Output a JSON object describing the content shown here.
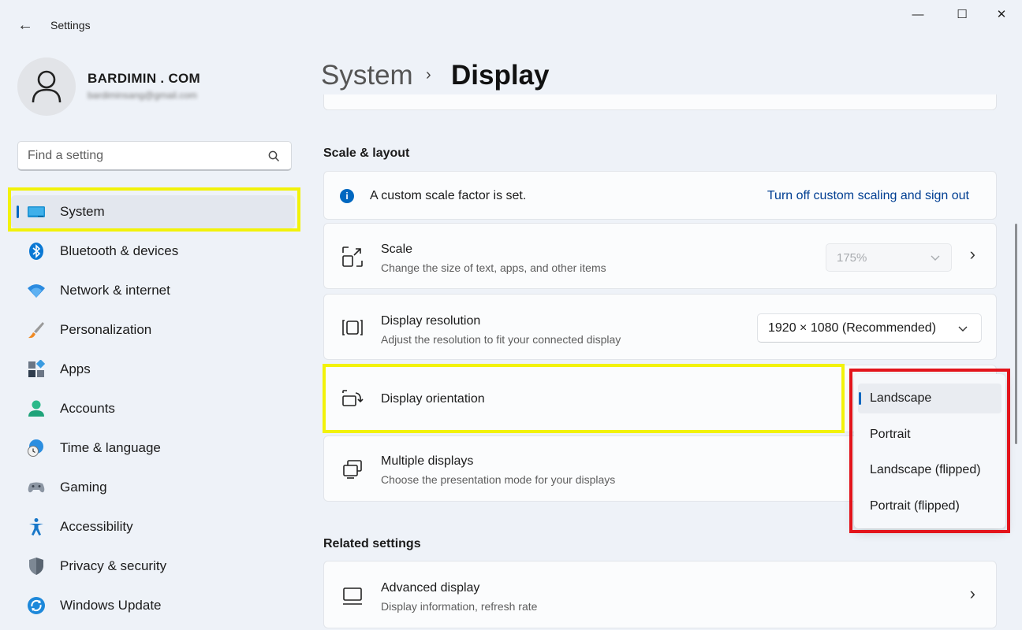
{
  "window": {
    "title": "Settings",
    "back_glyph": "←",
    "minimize_glyph": "—",
    "maximize_glyph": "☐",
    "close_glyph": "✕"
  },
  "profile": {
    "name": "BARDIMIN . COM",
    "email": "bardiminsang@gmail.com"
  },
  "search": {
    "placeholder": "Find a setting"
  },
  "sidebar": {
    "items": [
      {
        "label": "System",
        "icon": "system-icon",
        "active": true
      },
      {
        "label": "Bluetooth & devices",
        "icon": "bluetooth-icon"
      },
      {
        "label": "Network & internet",
        "icon": "wifi-icon"
      },
      {
        "label": "Personalization",
        "icon": "brush-icon"
      },
      {
        "label": "Apps",
        "icon": "apps-icon"
      },
      {
        "label": "Accounts",
        "icon": "accounts-icon"
      },
      {
        "label": "Time & language",
        "icon": "clock-globe-icon"
      },
      {
        "label": "Gaming",
        "icon": "gamepad-icon"
      },
      {
        "label": "Accessibility",
        "icon": "accessibility-icon"
      },
      {
        "label": "Privacy & security",
        "icon": "shield-icon"
      },
      {
        "label": "Windows Update",
        "icon": "update-icon"
      }
    ]
  },
  "header": {
    "parent": "System",
    "separator": "›",
    "current": "Display"
  },
  "scale_layout": {
    "section_title": "Scale & layout",
    "info": {
      "icon_glyph": "i",
      "text": "A custom scale factor is set.",
      "link": "Turn off custom scaling and sign out"
    },
    "scale": {
      "title": "Scale",
      "subtitle": "Change the size of text, apps, and other items",
      "value": "175%",
      "chevron": "›"
    },
    "resolution": {
      "title": "Display resolution",
      "subtitle": "Adjust the resolution to fit your connected display",
      "value": "1920 × 1080 (Recommended)"
    },
    "orientation": {
      "title": "Display orientation"
    },
    "multiple": {
      "title": "Multiple displays",
      "subtitle": "Choose the presentation mode for your displays"
    }
  },
  "related": {
    "section_title": "Related settings",
    "advanced": {
      "title": "Advanced display",
      "subtitle": "Display information, refresh rate",
      "chevron": "›"
    }
  },
  "orientation_menu": {
    "options": [
      "Landscape",
      "Portrait",
      "Landscape (flipped)",
      "Portrait (flipped)"
    ],
    "selected": "Landscape"
  },
  "colors": {
    "accent": "#0067c0",
    "highlight_yellow": "#f2f20a",
    "highlight_red": "#e3141b",
    "link": "#003e92"
  }
}
